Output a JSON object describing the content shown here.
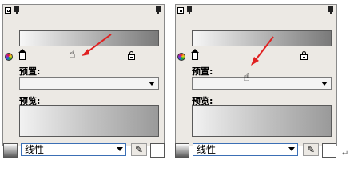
{
  "panels": [
    {
      "preset_label": "预置:",
      "preview_label": "预览:",
      "preset_value": "",
      "cursor_location": "beside-home-icon"
    },
    {
      "preset_label": "预置:",
      "preview_label": "预览:",
      "preset_value": "",
      "cursor_location": "over-preset-dropdown"
    }
  ],
  "toolbars": [
    {
      "type_value": "线性"
    },
    {
      "type_value": "线性"
    }
  ],
  "icons": {
    "restore": "restore-icon",
    "pin": "pin-icon",
    "color": "color-wheel-icon",
    "home": "home-icon",
    "lock": "lock-icon",
    "hand": "hand-cursor-icon",
    "pencil": "pencil-icon"
  },
  "colors": {
    "annotation_arrow": "#e02020",
    "select_border": "#3b6fb5"
  },
  "misc": {
    "hand_glyph": "☝",
    "pencil_glyph": "✎",
    "return_glyph": "↵"
  }
}
